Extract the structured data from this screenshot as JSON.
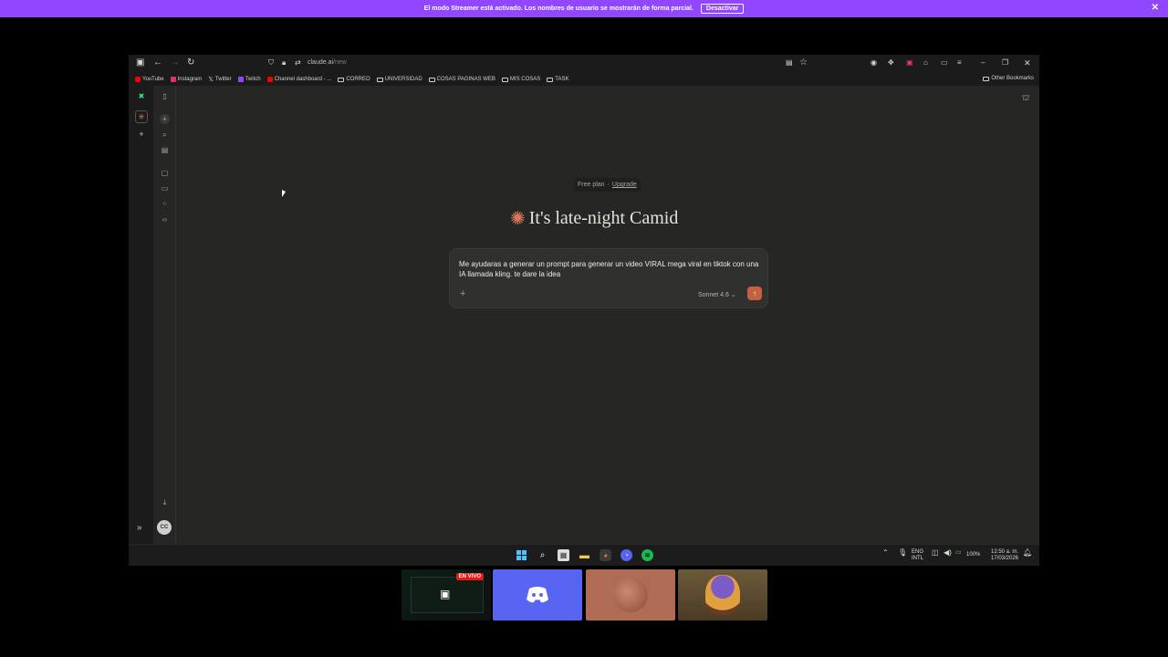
{
  "banner": {
    "message": "El modo Streamer está activado. Los nombres de usuario se mostrarán de forma parcial.",
    "button": "Desactivar",
    "close": "✕"
  },
  "browser": {
    "url_host": "claude.ai",
    "url_path": "/new",
    "bookmarks": [
      {
        "label": "YouTube",
        "color": "#ff0000"
      },
      {
        "label": "Instagram",
        "color": "#e1306c"
      },
      {
        "label": "Twitter",
        "color": "#ffffff"
      },
      {
        "label": "Twitch",
        "color": "#9147ff"
      },
      {
        "label": "Channel dashboard - ...",
        "color": "#ff0000"
      }
    ],
    "folders": [
      "CORREO",
      "UNIVERSIDAD",
      "COSAS PAGINAS WEB",
      "MIS COSAS",
      "TASK"
    ],
    "other_bookmarks": "Other Bookmarks"
  },
  "claude": {
    "plan_label": "Free plan",
    "plan_sep": "·",
    "upgrade_label": "Upgrade",
    "greeting": "It's late-night Camid",
    "prompt_text": "Me ayudaras a generar un prompt para generar un video VIRAL mega viral en tiktok con una IA llamada kling. te dare la idea",
    "model_label": "Sonnet 4.6 ⌄",
    "avatar_initials": "CC"
  },
  "taskbar": {
    "lang": "ENG",
    "layout": "INTL",
    "battery": "100%",
    "time": "12:50 a. m.",
    "date": "17/03/2026"
  },
  "stream_tiles": {
    "live_badge": "EN VIVO"
  },
  "colors": {
    "accent": "#c6613f",
    "streamer_banner": "#9147ff",
    "discord": "#5865f2"
  }
}
